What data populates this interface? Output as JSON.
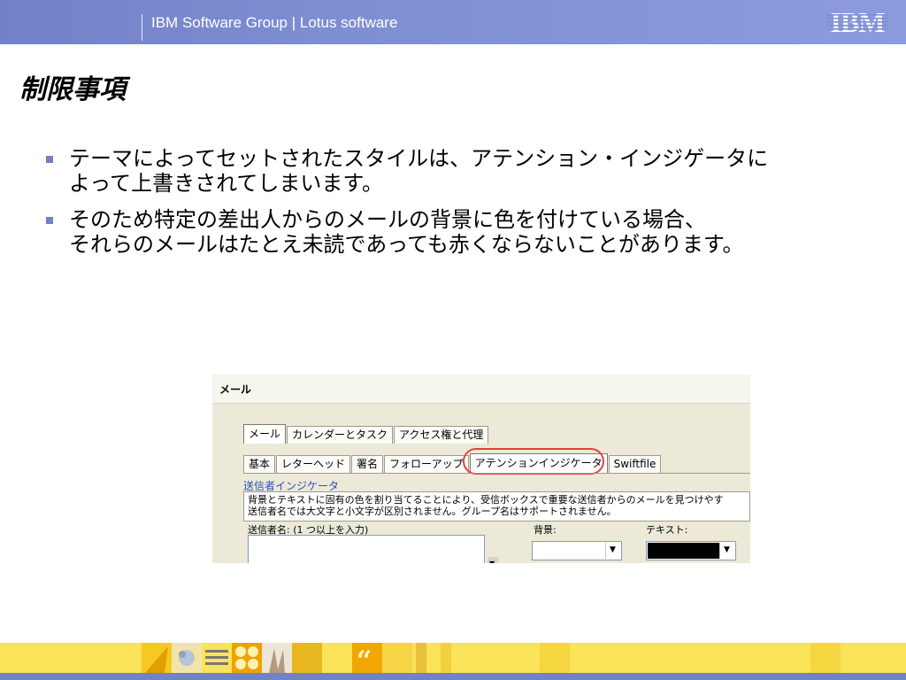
{
  "header": {
    "brand": "IBM Software Group | Lotus software",
    "logo_text": "IBM"
  },
  "title": "制限事項",
  "bullets": [
    {
      "lines": [
        "テーマによってセットされたスタイルは、アテンション・インジゲータに",
        "よって上書きされてしまいます。"
      ]
    },
    {
      "lines": [
        "そのため特定の差出人からのメールの背景に色を付けている場合、",
        "それらのメールはたとえ未読であっても赤くならないことがあります。"
      ]
    }
  ],
  "dialog": {
    "title": "メール",
    "tabs_top": [
      "メール",
      "カレンダーとタスク",
      "アクセス権と代理"
    ],
    "tabs_bottom": [
      "基本",
      "レターヘッド",
      "署名",
      "フォローアップ",
      "アテンションインジケータ",
      "Swiftfile"
    ],
    "active_tab": "アテンションインジケータ",
    "section_title": "送信者インジケータ",
    "description": [
      "背景とテキストに固有の色を割り当てることにより、受信ボックスで重要な送信者からのメールを見つけやす",
      "送信者名では大文字と小文字が区別されません。グループ名はサポートされません。"
    ],
    "sender_label": "送信者名: (1 つ以上を入力)",
    "background_label": "背景:",
    "text_label": "テキスト:",
    "background_color": "#ffffff",
    "text_color": "#000000"
  },
  "colors": {
    "header_blue": "#7381c8",
    "footer_yellow": "#fbe35a",
    "highlight_red": "#e0443c",
    "section_blue": "#2a4fb4"
  }
}
